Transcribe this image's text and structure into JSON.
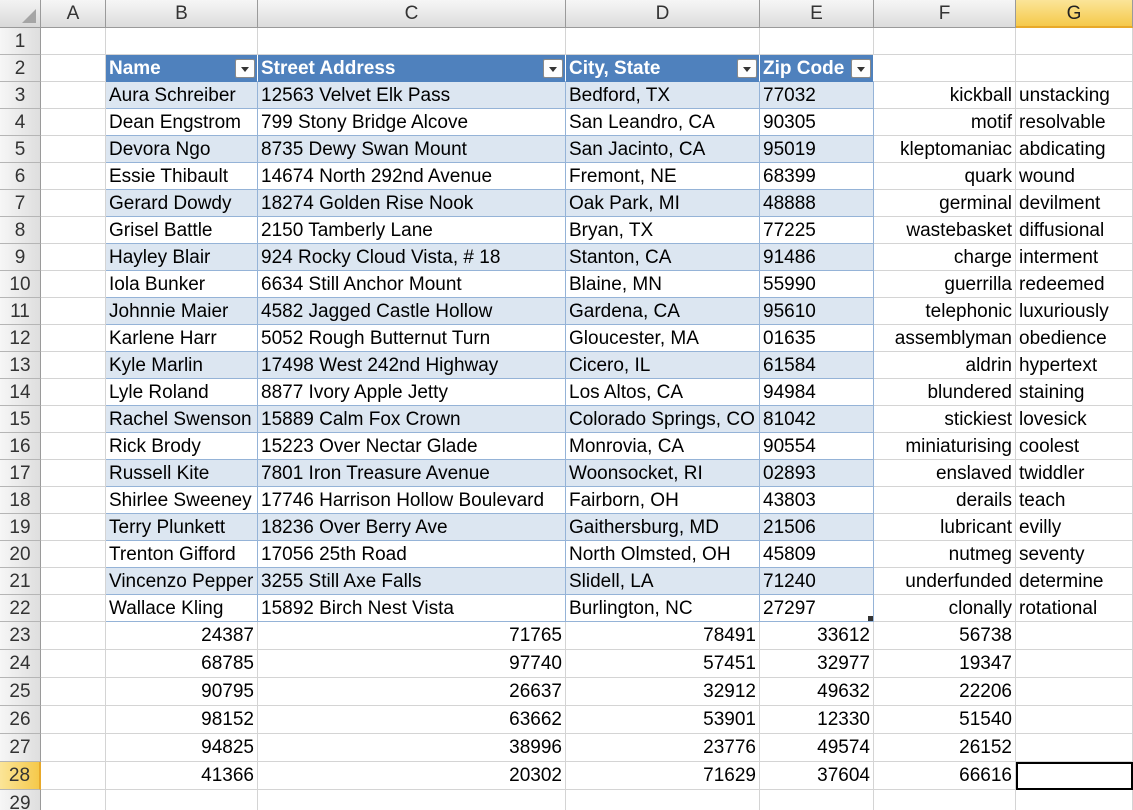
{
  "columns": [
    "A",
    "B",
    "C",
    "D",
    "E",
    "F",
    "G"
  ],
  "active_column": "G",
  "rows": [
    "1",
    "2",
    "3",
    "4",
    "5",
    "6",
    "7",
    "8",
    "9",
    "10",
    "11",
    "12",
    "13",
    "14",
    "15",
    "16",
    "17",
    "18",
    "19",
    "20",
    "21",
    "22",
    "23",
    "24",
    "25",
    "26",
    "27",
    "28",
    "29"
  ],
  "active_row": "28",
  "table": {
    "headers": [
      "Name",
      "Street Address",
      "City,  State",
      "Zip Code"
    ],
    "rows": [
      [
        "Aura Schreiber",
        "12563 Velvet Elk Pass",
        "Bedford, TX",
        "77032"
      ],
      [
        "Dean Engstrom",
        "799 Stony Bridge Alcove",
        "San Leandro, CA",
        "90305"
      ],
      [
        "Devora Ngo",
        "8735 Dewy Swan Mount",
        "San Jacinto, CA",
        "95019"
      ],
      [
        "Essie Thibault",
        "14674 North 292nd Avenue",
        "Fremont, NE",
        "68399"
      ],
      [
        "Gerard Dowdy",
        "18274 Golden Rise Nook",
        "Oak Park, MI",
        "48888"
      ],
      [
        "Grisel Battle",
        "2150 Tamberly Lane",
        "Bryan, TX",
        "77225"
      ],
      [
        "Hayley Blair",
        "924 Rocky Cloud Vista,  # 18",
        "Stanton, CA",
        "91486"
      ],
      [
        "Iola Bunker",
        "6634 Still Anchor Mount",
        "Blaine, MN",
        "55990"
      ],
      [
        "Johnnie Maier",
        "4582 Jagged Castle Hollow",
        "Gardena, CA",
        "95610"
      ],
      [
        "Karlene Harr",
        "5052 Rough Butternut Turn",
        "Gloucester, MA",
        "01635"
      ],
      [
        "Kyle Marlin",
        "17498 West 242nd Highway",
        "Cicero, IL",
        "61584"
      ],
      [
        "Lyle Roland",
        "8877 Ivory Apple Jetty",
        "Los Altos, CA",
        "94984"
      ],
      [
        "Rachel Swenson",
        "15889 Calm Fox Crown",
        "Colorado Springs, CO",
        "81042"
      ],
      [
        "Rick Brody",
        "15223 Over Nectar Glade",
        "Monrovia, CA",
        "90554"
      ],
      [
        "Russell Kite",
        "7801 Iron Treasure Avenue",
        "Woonsocket, RI",
        "02893"
      ],
      [
        "Shirlee Sweeney",
        "17746 Harrison Hollow Boulevard",
        "Fairborn, OH",
        "43803"
      ],
      [
        "Terry Plunkett",
        "18236 Over Berry Ave",
        "Gaithersburg, MD",
        "21506"
      ],
      [
        "Trenton Gifford",
        "17056  25th Road",
        "North Olmsted, OH",
        "45809"
      ],
      [
        "Vincenzo Pepper",
        "3255 Still Axe Falls",
        "Slidell, LA",
        "71240"
      ],
      [
        "Wallace Kling",
        "15892 Birch Nest Vista",
        "Burlington, NC",
        "27297"
      ]
    ]
  },
  "words_f": [
    "kickball",
    "motif",
    "kleptomaniac",
    "quark",
    "germinal",
    "wastebasket",
    "charge",
    "guerrilla",
    "telephonic",
    "assemblyman",
    "aldrin",
    "blundered",
    "stickiest",
    "miniaturising",
    "enslaved",
    "derails",
    "lubricant",
    "nutmeg",
    "underfunded",
    "clonally"
  ],
  "words_g": [
    "unstacking",
    "resolvable",
    "abdicating",
    "wound",
    "devilment",
    "diffusional",
    "interment",
    "redeemed",
    "luxuriously",
    "obedience",
    "hypertext",
    "staining",
    "lovesick",
    "coolest",
    "twiddler",
    "teach",
    "evilly",
    "seventy",
    "determine",
    "rotational"
  ],
  "numbers": [
    [
      "24387",
      "71765",
      "78491",
      "33612",
      "56738"
    ],
    [
      "68785",
      "97740",
      "57451",
      "32977",
      "19347"
    ],
    [
      "90795",
      "26637",
      "32912",
      "49632",
      "22206"
    ],
    [
      "98152",
      "63662",
      "53901",
      "12330",
      "51540"
    ],
    [
      "94825",
      "38996",
      "23776",
      "49574",
      "26152"
    ],
    [
      "41366",
      "20302",
      "71629",
      "37604",
      "66616"
    ]
  ],
  "colors": {
    "table_header": "#4f81bd",
    "table_band": "#dce6f1",
    "active_header": "#f5c94b"
  }
}
